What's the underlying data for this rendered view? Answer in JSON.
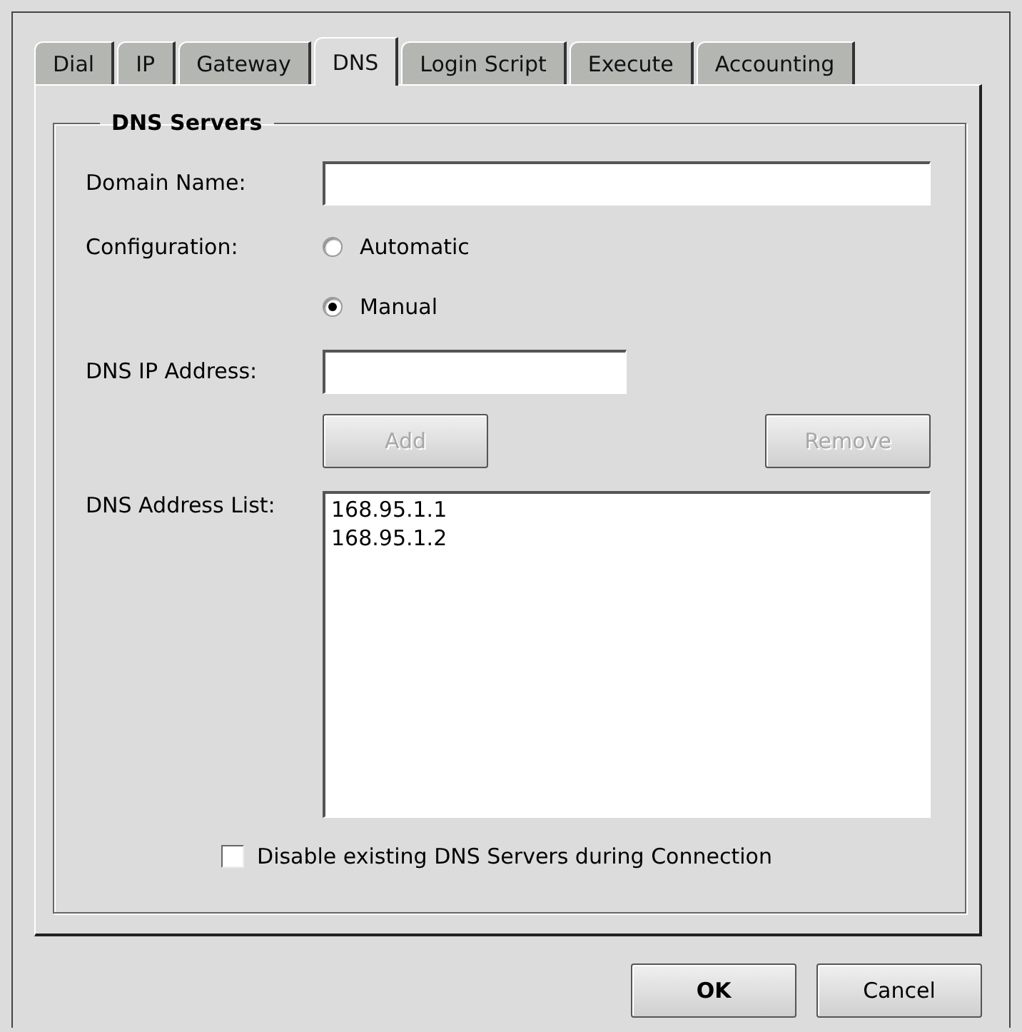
{
  "tabs": [
    {
      "label": "Dial",
      "selected": false
    },
    {
      "label": "IP",
      "selected": false
    },
    {
      "label": "Gateway",
      "selected": false
    },
    {
      "label": "DNS",
      "selected": true
    },
    {
      "label": "Login Script",
      "selected": false
    },
    {
      "label": "Execute",
      "selected": false
    },
    {
      "label": "Accounting",
      "selected": false
    }
  ],
  "group": {
    "title": "DNS Servers",
    "domain_name": {
      "label": "Domain Name:"
    },
    "configuration": {
      "label": "Configuration:",
      "options": [
        {
          "label": "Automatic",
          "selected": false
        },
        {
          "label": "Manual",
          "selected": true
        }
      ]
    },
    "dns_ip": {
      "label": "DNS IP Address:"
    },
    "buttons": [
      {
        "label": "Add",
        "disabled": true
      },
      {
        "label": "Remove",
        "disabled": true
      }
    ],
    "address_list": {
      "label": "DNS Address List:",
      "items": [
        "168.95.1.1",
        "168.95.1.2"
      ]
    },
    "disable_existing": {
      "label": "Disable existing DNS Servers during Connection",
      "checked": false
    }
  },
  "dialog_buttons": [
    {
      "label": "OK",
      "default": true
    },
    {
      "label": "Cancel",
      "default": false
    }
  ]
}
